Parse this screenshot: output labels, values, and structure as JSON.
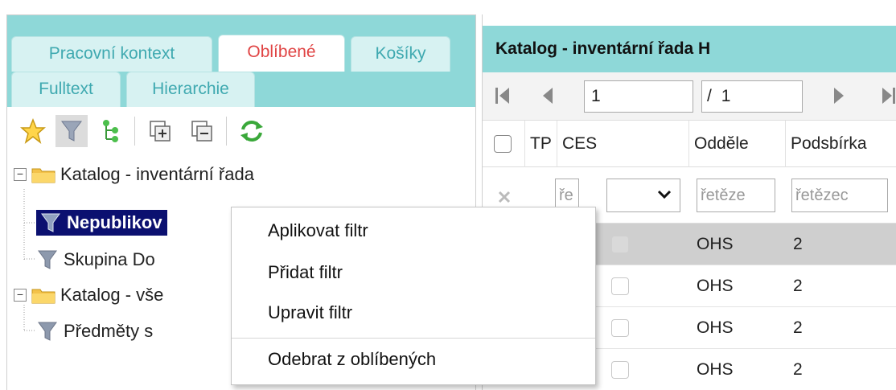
{
  "left_panel": {
    "tabs": [
      {
        "label": "Pracovní kontext"
      },
      {
        "label": "Oblíbené"
      },
      {
        "label": "Košíky"
      },
      {
        "label": "Fulltext"
      },
      {
        "label": "Hierarchie"
      }
    ],
    "active_tab": "Oblíbené",
    "toolbar_icons": [
      "star-icon",
      "filter-icon",
      "tree-icon",
      "expand-all-icon",
      "collapse-all-icon",
      "refresh-icon"
    ],
    "tree": [
      {
        "label": "Katalog - inventární řada",
        "icon": "folder-icon",
        "expander": "−"
      },
      {
        "label": "Nepublikov",
        "icon": "filter-icon",
        "selected": true
      },
      {
        "label": "Skupina Do",
        "icon": "filter-icon"
      },
      {
        "label": "Katalog - vše",
        "icon": "folder-icon",
        "expander": "−"
      },
      {
        "label": "Předměty s",
        "icon": "filter-icon"
      }
    ]
  },
  "right_panel": {
    "title": "Katalog - inventární řada H",
    "pager": {
      "current_page": "1",
      "total_prefix": "/",
      "total_pages": "1"
    },
    "columns": [
      "TP",
      "CES",
      "Oddĕle",
      "Podsbírka"
    ],
    "filters": {
      "tp": "ře",
      "odd": "řetěze",
      "podsbirka": "řetězec"
    },
    "rows": [
      {
        "oddeleni": "OHS",
        "podsbirka": "2"
      },
      {
        "oddeleni": "OHS",
        "podsbirka": "2"
      },
      {
        "oddeleni": "OHS",
        "podsbirka": "2"
      },
      {
        "oddeleni": "OHS",
        "podsbirka": "2"
      }
    ]
  },
  "context_menu": {
    "items": [
      "Aplikovat filtr",
      "Přidat filtr",
      "Upravit filtr",
      "Odebrat z oblíbených"
    ]
  },
  "colors": {
    "tab_bar": "#8ed8d8",
    "tab_text": "#3fa9b0",
    "active_tab_text": "#e04444",
    "selection": "#0b1070",
    "highlight_row": "#cfcfcf"
  }
}
